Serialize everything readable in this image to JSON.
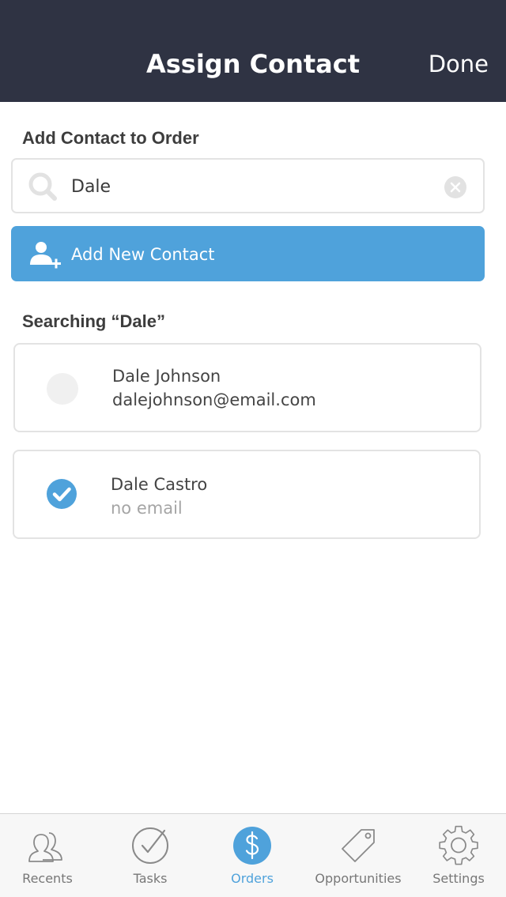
{
  "header": {
    "title": "Assign Contact",
    "done_label": "Done"
  },
  "add_section": {
    "heading": "Add Contact to Order",
    "search_value": "Dale",
    "add_button_label": "Add New Contact"
  },
  "results": {
    "heading": "Searching “Dale”",
    "items": [
      {
        "name": "Dale Johnson",
        "email": "dalejohnson@email.com",
        "selected": false
      },
      {
        "name": "Dale Castro",
        "email": "no email",
        "selected": true
      }
    ]
  },
  "tabbar": {
    "items": [
      {
        "label": "Recents",
        "icon": "people-icon",
        "active": false
      },
      {
        "label": "Tasks",
        "icon": "checkmark-circle-icon",
        "active": false
      },
      {
        "label": "Orders",
        "icon": "dollar-icon",
        "active": true
      },
      {
        "label": "Opportunities",
        "icon": "tag-icon",
        "active": false
      },
      {
        "label": "Settings",
        "icon": "gear-icon",
        "active": false
      }
    ]
  },
  "colors": {
    "header_bg": "#2f3343",
    "accent": "#4fa2db"
  }
}
